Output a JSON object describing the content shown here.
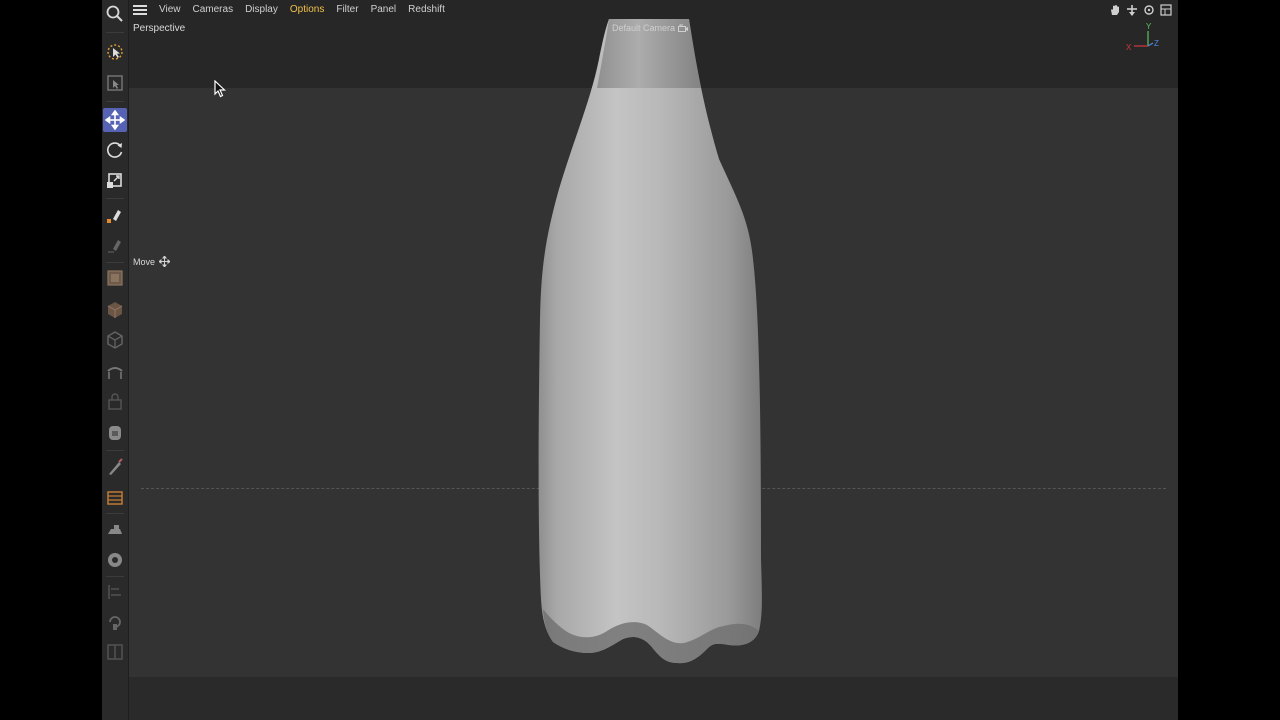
{
  "menubar": {
    "items": [
      "View",
      "Cameras",
      "Display",
      "Options",
      "Filter",
      "Panel",
      "Redshift"
    ],
    "highlighted": "Options",
    "highlight_color": "#f0c04a"
  },
  "viewport": {
    "view_name": "Perspective",
    "camera_name": "Default Camera",
    "tool_hint": "Move",
    "axis_labels": {
      "x": "X",
      "y": "Y",
      "z": "Z"
    },
    "axis_colors": {
      "x": "#d23a3a",
      "y": "#5ec25e",
      "z": "#4a8ae0"
    }
  },
  "toolbar": {
    "active_tool": "move-tool",
    "active_color": "#5662b3",
    "tools": [
      "select-tool",
      "render-region-tool",
      "move-tool",
      "rotate-tool",
      "scale-tool",
      "pen-tool",
      "sketch-tool",
      "cube-tool",
      "subdivision-tool",
      "deformer-tool",
      "spline-tool",
      "lock-tool",
      "camera-tool",
      "brush-tool",
      "layers-tool",
      "iron-tool",
      "target-tool",
      "align-tool",
      "rotate-view-tool",
      "split-panel-tool"
    ]
  },
  "view_icons": [
    "hand-icon",
    "pan-down-icon",
    "refresh-icon",
    "maximize-icon"
  ]
}
